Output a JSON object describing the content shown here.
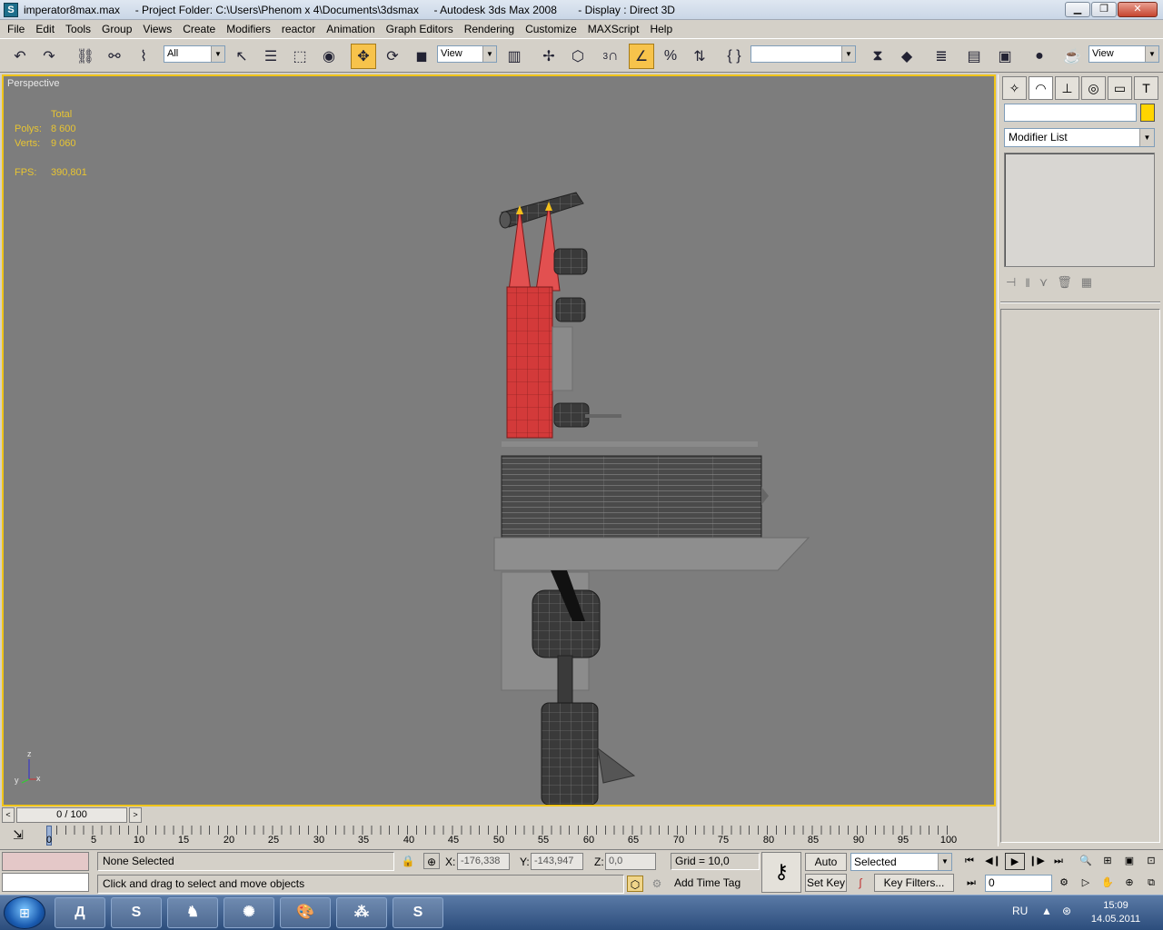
{
  "window": {
    "title": "imperator8max.max     - Project Folder: C:\\Users\\Phenom x 4\\Documents\\3dsmax     - Autodesk 3ds Max 2008       - Display : Direct 3D",
    "icon": "3ds-max-icon"
  },
  "menu": [
    "File",
    "Edit",
    "Tools",
    "Group",
    "Views",
    "Create",
    "Modifiers",
    "reactor",
    "Animation",
    "Graph Editors",
    "Rendering",
    "Customize",
    "MAXScript",
    "Help"
  ],
  "toolbar": {
    "selection_filter": "All",
    "ref_coord": "View",
    "named_selection": "",
    "render_view": "View",
    "snap_label": "3"
  },
  "viewport": {
    "label": "Perspective",
    "stats": {
      "header": "Total",
      "polys_label": "Polys:",
      "polys_value": "8 600",
      "verts_label": "Verts:",
      "verts_value": "9 060",
      "fps_label": "FPS:",
      "fps_value": "390,801"
    },
    "axis": {
      "z": "z",
      "x": "x",
      "y": "y"
    }
  },
  "command_panel": {
    "object_name": "",
    "modifier_list": "Modifier List",
    "object_color": "#ffd500"
  },
  "time_slider": {
    "position": "0 / 100"
  },
  "track": {
    "ticks": [
      "0",
      "5",
      "10",
      "15",
      "20",
      "25",
      "30",
      "35",
      "40",
      "45",
      "50",
      "55",
      "60",
      "65",
      "70",
      "75",
      "80",
      "85",
      "90",
      "95",
      "100"
    ]
  },
  "status": {
    "selection": "None Selected",
    "prompt": "Click and drag to select and move objects",
    "x_label": "X:",
    "x_value": "-176,338",
    "y_label": "Y:",
    "y_value": "-143,947",
    "z_label": "Z:",
    "z_value": "0,0",
    "grid": "Grid = 10,0",
    "add_time_tag": "Add Time Tag",
    "auto_key": "Auto Key",
    "set_key": "Set Key",
    "key_mode": "Selected",
    "key_filters": "Key Filters...",
    "current_frame": "0"
  },
  "taskbar": {
    "apps": [
      "start-button",
      "daemon-tools",
      "3ds-max",
      "game-app-1",
      "game-app-2",
      "paint",
      "media-app",
      "skype"
    ],
    "language": "RU",
    "time": "15:09",
    "date": "14.05.2011"
  },
  "colors": {
    "viewport_bg": "#7d7d7d",
    "active_border": "#f0c419",
    "stats_text": "#e8c532",
    "selected_red": "#d33a3a"
  }
}
